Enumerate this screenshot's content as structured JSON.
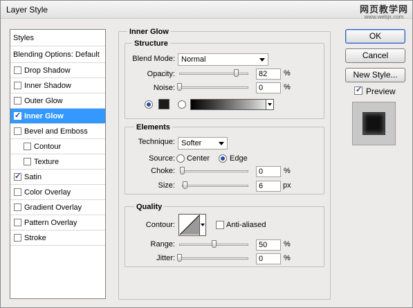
{
  "window": {
    "title": "Layer Style"
  },
  "watermark": {
    "line1": "网页教学网",
    "line2": "www.webjx.com"
  },
  "styles_list": {
    "header": "Styles",
    "blending_options": "Blending Options: Default",
    "items": [
      {
        "label": "Drop Shadow",
        "checked": false,
        "indent": false,
        "selected": false
      },
      {
        "label": "Inner Shadow",
        "checked": false,
        "indent": false,
        "selected": false
      },
      {
        "label": "Outer Glow",
        "checked": false,
        "indent": false,
        "selected": false
      },
      {
        "label": "Inner Glow",
        "checked": true,
        "indent": false,
        "selected": true
      },
      {
        "label": "Bevel and Emboss",
        "checked": false,
        "indent": false,
        "selected": false
      },
      {
        "label": "Contour",
        "checked": false,
        "indent": true,
        "selected": false
      },
      {
        "label": "Texture",
        "checked": false,
        "indent": true,
        "selected": false
      },
      {
        "label": "Satin",
        "checked": true,
        "indent": false,
        "selected": false
      },
      {
        "label": "Color Overlay",
        "checked": false,
        "indent": false,
        "selected": false
      },
      {
        "label": "Gradient Overlay",
        "checked": false,
        "indent": false,
        "selected": false
      },
      {
        "label": "Pattern Overlay",
        "checked": false,
        "indent": false,
        "selected": false
      },
      {
        "label": "Stroke",
        "checked": false,
        "indent": false,
        "selected": false
      }
    ]
  },
  "inner_glow": {
    "title": "Inner Glow",
    "structure": {
      "title": "Structure",
      "blend_mode_label": "Blend Mode:",
      "blend_mode_value": "Normal",
      "opacity_label": "Opacity:",
      "opacity_value": "82",
      "opacity_unit": "%",
      "opacity_level": 0.82,
      "noise_label": "Noise:",
      "noise_value": "0",
      "noise_unit": "%",
      "noise_level": 0.0,
      "color_swatch": "#1b1b1b"
    },
    "elements": {
      "title": "Elements",
      "technique_label": "Technique:",
      "technique_value": "Softer",
      "source_label": "Source:",
      "source_center": "Center",
      "source_edge": "Edge",
      "choke_label": "Choke:",
      "choke_value": "0",
      "choke_unit": "%",
      "choke_level": 0.0,
      "size_label": "Size:",
      "size_value": "6",
      "size_unit": "px",
      "size_level": 0.04
    },
    "quality": {
      "title": "Quality",
      "contour_label": "Contour:",
      "anti_aliased_label": "Anti-aliased",
      "range_label": "Range:",
      "range_value": "50",
      "range_unit": "%",
      "range_level": 0.5,
      "jitter_label": "Jitter:",
      "jitter_value": "0",
      "jitter_unit": "%",
      "jitter_level": 0.0
    }
  },
  "buttons": {
    "ok": "OK",
    "cancel": "Cancel",
    "new_style": "New Style..."
  },
  "preview": {
    "label": "Preview",
    "checked": true
  }
}
